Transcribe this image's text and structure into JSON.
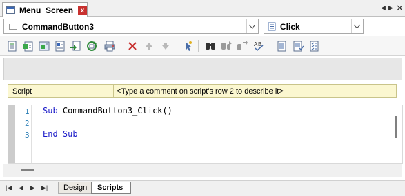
{
  "document_tab": {
    "title": "Menu_Screen",
    "close_glyph": "x"
  },
  "strip_controls": {
    "left": "◀",
    "right": "▶",
    "close": "✕"
  },
  "object_combo": {
    "icon": "button-object-icon",
    "value": "CommandButton3"
  },
  "event_combo": {
    "icon": "event-list-icon",
    "value": "Click"
  },
  "toolbar": {
    "buttons": [
      "new-script-icon",
      "add-script-icon",
      "image-script-icon",
      "form-script-icon",
      "import-script-icon",
      "refresh-script-icon",
      "print-icon",
      "delete-icon",
      "move-up-icon",
      "move-down-icon",
      "cursor-icon",
      "find-icon",
      "find-next-icon",
      "replace-icon",
      "spell-check-icon",
      "list-icon",
      "checklist-icon",
      "checklist-alt-icon"
    ]
  },
  "script_bar": {
    "label": "Script",
    "comment": "<Type a comment on script's row 2 to describe it>"
  },
  "editor": {
    "line_numbers": [
      "1",
      "2",
      "3"
    ],
    "lines": [
      {
        "keyword": "Sub",
        "text": " CommandButton3_Click()"
      },
      {
        "keyword": "",
        "text": ""
      },
      {
        "keyword": "End Sub",
        "text": ""
      }
    ]
  },
  "bottom_nav": {
    "first": "|◀",
    "prev": "◀",
    "next": "▶",
    "last": "▶|",
    "tabs": [
      "Design",
      "Scripts"
    ],
    "active_tab": "Scripts"
  },
  "colors": {
    "keyword": "#1a1ac8",
    "line_number": "#2a7eb5",
    "comment_bar": "#fbf7d0",
    "close_red": "#c8312f"
  }
}
